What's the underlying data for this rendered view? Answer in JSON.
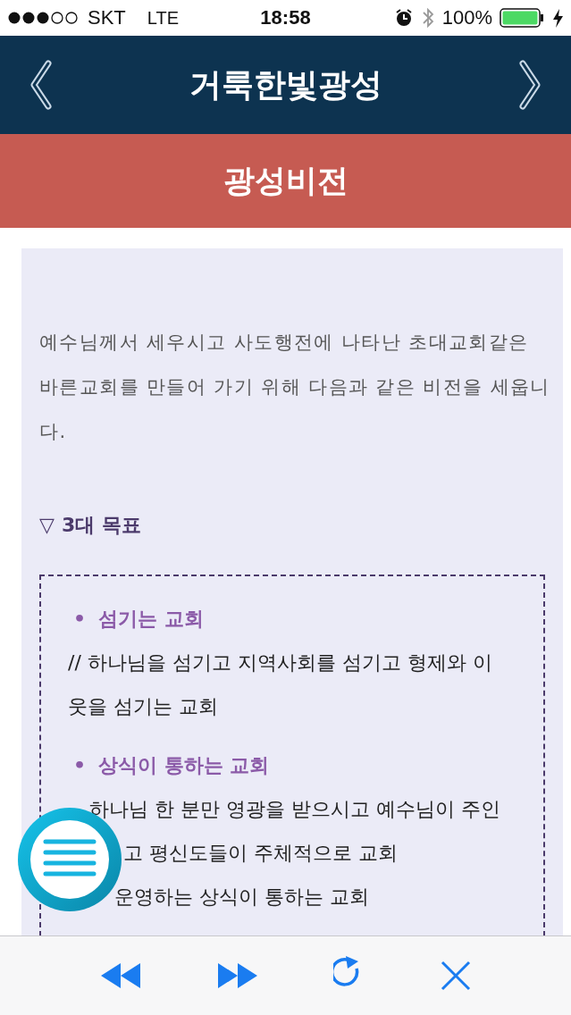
{
  "status_bar": {
    "carrier": "SKT",
    "network": "LTE",
    "time": "18:58",
    "battery": "100%"
  },
  "header": {
    "title": "거룩한빛광성"
  },
  "banner": {
    "title": "광성비전"
  },
  "intro": "예수님께서 세우시고 사도행전에 나타난 초대교회같은 바른교회를 만들어 가기 위해 다음과 같은 비전을 세웁니다.",
  "section": {
    "marker": "▽",
    "title": "3대 목표"
  },
  "goals": [
    {
      "bullet": "•",
      "title": "섬기는 교회",
      "lines": [
        "// 하나님을 섬기고 지역사회를 섬기고 형제와 이",
        "웃을 섬기는 교회"
      ]
    },
    {
      "bullet": "•",
      "title": "상식이 통하는 교회",
      "lines": [
        "하나님 한 분만 영광을 받으시고 예수님이 주인",
        "고 평신도들이 주체적으로 교회",
        "운영하는 상식이 통하는 교회"
      ]
    }
  ]
}
